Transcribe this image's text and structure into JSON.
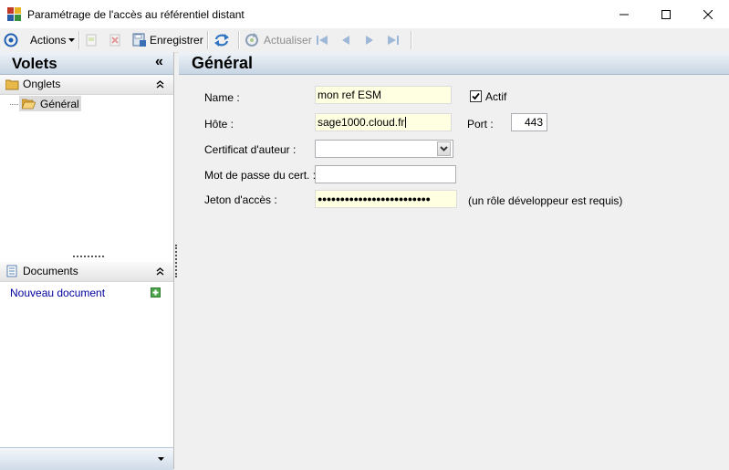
{
  "window": {
    "title": "Paramétrage de l'accès au référentiel distant",
    "controls": [
      "minimize",
      "maximize",
      "close"
    ]
  },
  "toolbar": {
    "actions_label": "Actions",
    "save_label": "Enregistrer",
    "refresh_label": "Actualiser"
  },
  "left_panel": {
    "title": "Volets",
    "collapse_glyph": "«",
    "tabs_section": {
      "label": "Onglets",
      "items": [
        {
          "label": "Général"
        }
      ]
    },
    "documents_section": {
      "label": "Documents",
      "new_document_label": "Nouveau document"
    }
  },
  "main": {
    "title": "Général",
    "form": {
      "name_label": "Name :",
      "name_value": "mon ref ESM",
      "active_label": "Actif",
      "active_checked": true,
      "host_label": "Hôte :",
      "host_value": "sage1000.cloud.fr",
      "port_label": "Port :",
      "port_value": "443",
      "cert_label": "Certificat d'auteur :",
      "cert_value": "",
      "cert_password_label": "Mot de passe du cert. :",
      "cert_password_value": "",
      "token_label": "Jeton d'accès :",
      "token_value": "●●●●●●●●●●●●●●●●●●●●●●●●●",
      "token_hint": "(un rôle développeur est requis)"
    }
  },
  "colors": {
    "header_gradient_top": "#eef3f8",
    "header_gradient_bottom": "#c7d5e4",
    "required_field_bg": "#ffffe1",
    "link_color": "#0000a0"
  }
}
